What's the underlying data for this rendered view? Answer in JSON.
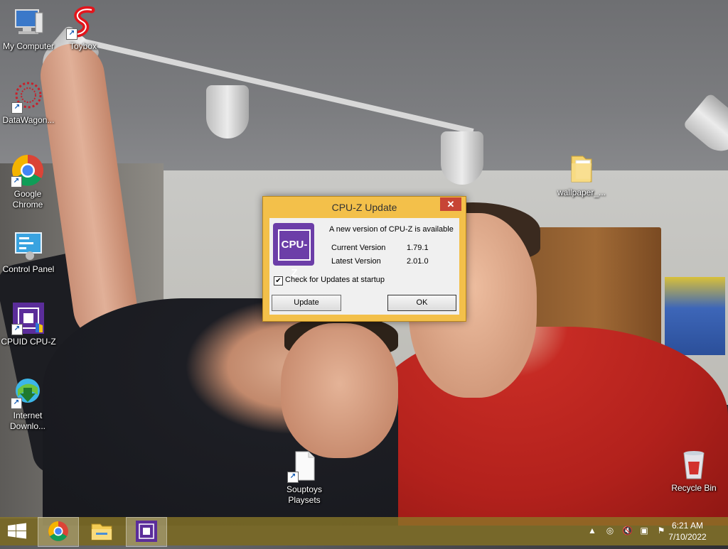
{
  "desktop": {
    "icons": [
      {
        "label": "My Computer",
        "icon": "computer-icon"
      },
      {
        "label": "Toybox",
        "icon": "toybox-icon"
      },
      {
        "label": "DataWagon...",
        "icon": "datawagon-icon"
      },
      {
        "label": "Google Chrome",
        "icon": "chrome-icon"
      },
      {
        "label": "Control Panel",
        "icon": "control-panel-icon"
      },
      {
        "label": "CPUID CPU-Z",
        "icon": "cpuz-icon"
      },
      {
        "label": "Internet Downlo...",
        "icon": "internet-download-manager-icon"
      },
      {
        "label": "wallpaper_...",
        "icon": "folder-icon"
      },
      {
        "label": "Souptoys Playsets",
        "icon": "document-icon"
      },
      {
        "label": "Recycle Bin",
        "icon": "recycle-bin-icon"
      }
    ]
  },
  "dialog": {
    "title": "CPU-Z Update",
    "logo_text": "CPU-Z",
    "message": "A new version of CPU-Z is available",
    "current_label": "Current Version",
    "current_value": "1.79.1",
    "latest_label": "Latest Version",
    "latest_value": "2.01.0",
    "checkbox_label": "Check for Updates at startup",
    "checkbox_checked": true,
    "update_label": "Update",
    "ok_label": "OK",
    "close_glyph": "✕"
  },
  "taskbar": {
    "time": "6:21 AM",
    "date": "7/10/2022",
    "pinned": [
      "start-icon",
      "chrome-icon",
      "file-explorer-icon",
      "cpuz-icon"
    ]
  },
  "colors": {
    "dialog_frame": "#f3c04a",
    "taskbar": "#8c7828",
    "close": "#c74535",
    "cpuz_purple": "#6c3ea8"
  }
}
